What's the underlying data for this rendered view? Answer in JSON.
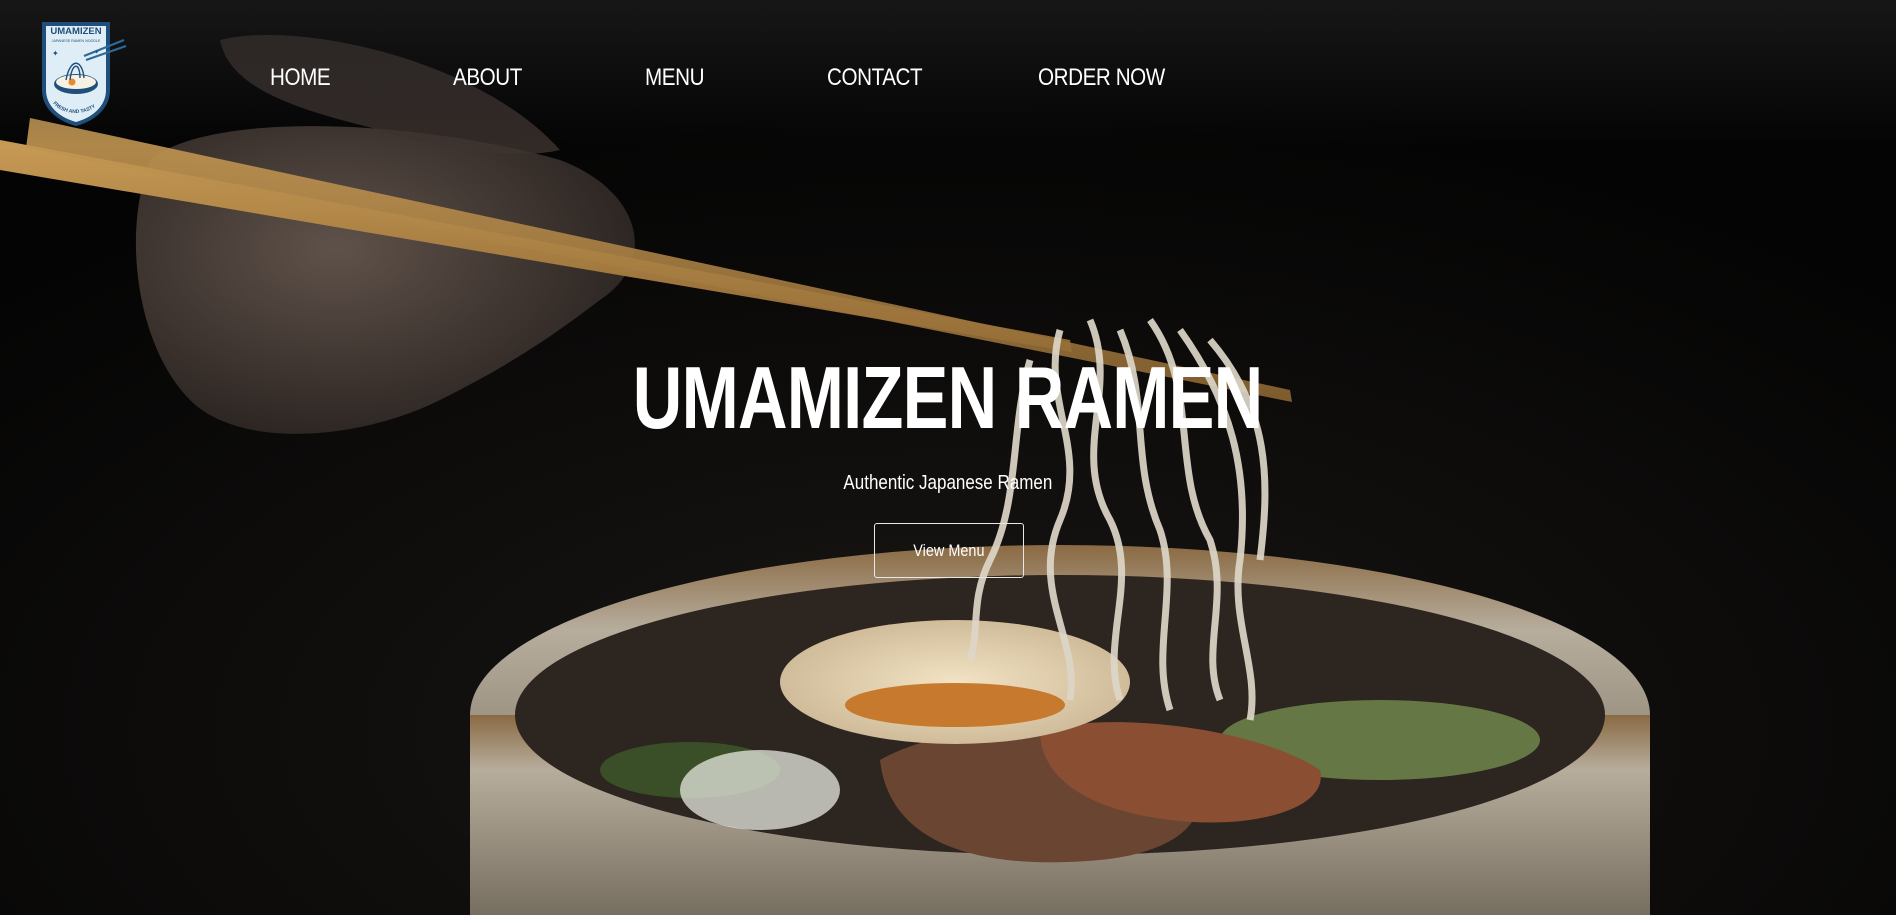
{
  "brand": {
    "logo_name": "UMAMIZEN",
    "logo_tagline": "JAPANESE RAMEN NOODLE",
    "logo_motto": "FRESH AND TASTY",
    "colors": {
      "logo_blue": "#1f4f7a",
      "logo_light": "#dfeef6",
      "accent_orange": "#e8892f"
    }
  },
  "nav": {
    "items": [
      {
        "label": "HOME"
      },
      {
        "label": "ABOUT"
      },
      {
        "label": "MENU"
      },
      {
        "label": "CONTACT"
      },
      {
        "label": "ORDER NOW"
      }
    ]
  },
  "hero": {
    "title": "UMAMIZEN RAMEN",
    "subtitle": "Authentic Japanese Ramen",
    "cta_label": "View Menu",
    "background_image": "photo-hand-with-chopsticks-lifting-noodles-from-ramen-bowl"
  }
}
